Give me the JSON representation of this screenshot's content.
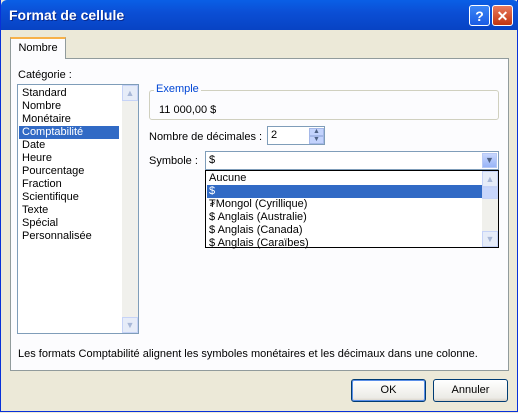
{
  "window": {
    "title": "Format de cellule",
    "help_label": "?",
    "close_label": "✕"
  },
  "tabs": [
    {
      "label": "Nombre"
    }
  ],
  "category": {
    "label": "Catégorie :",
    "items": [
      "Standard",
      "Nombre",
      "Monétaire",
      "Comptabilité",
      "Date",
      "Heure",
      "Pourcentage",
      "Fraction",
      "Scientifique",
      "Texte",
      "Spécial",
      "Personnalisée"
    ],
    "selected": "Comptabilité"
  },
  "sample": {
    "label": "Exemple",
    "value": "11 000,00  $"
  },
  "decimals": {
    "label": "Nombre de décimales :",
    "value": "2"
  },
  "symbol": {
    "label": "Symbole :",
    "value": "$",
    "options": [
      "Aucune",
      "$",
      "₮Mongol (Cyrillique)",
      "$ Anglais (Australie)",
      "$ Anglais (Canada)",
      "$ Anglais (Caraïbes)"
    ],
    "selected": "$"
  },
  "description": "Les formats Comptabilité alignent les symboles monétaires et les décimaux dans une colonne.",
  "buttons": {
    "ok": "OK",
    "cancel": "Annuler"
  },
  "colors": {
    "titlebar": "#0b4fd6",
    "selection": "#316ac5",
    "group_label": "#0046d5",
    "tab_accent": "#f7b14a"
  }
}
